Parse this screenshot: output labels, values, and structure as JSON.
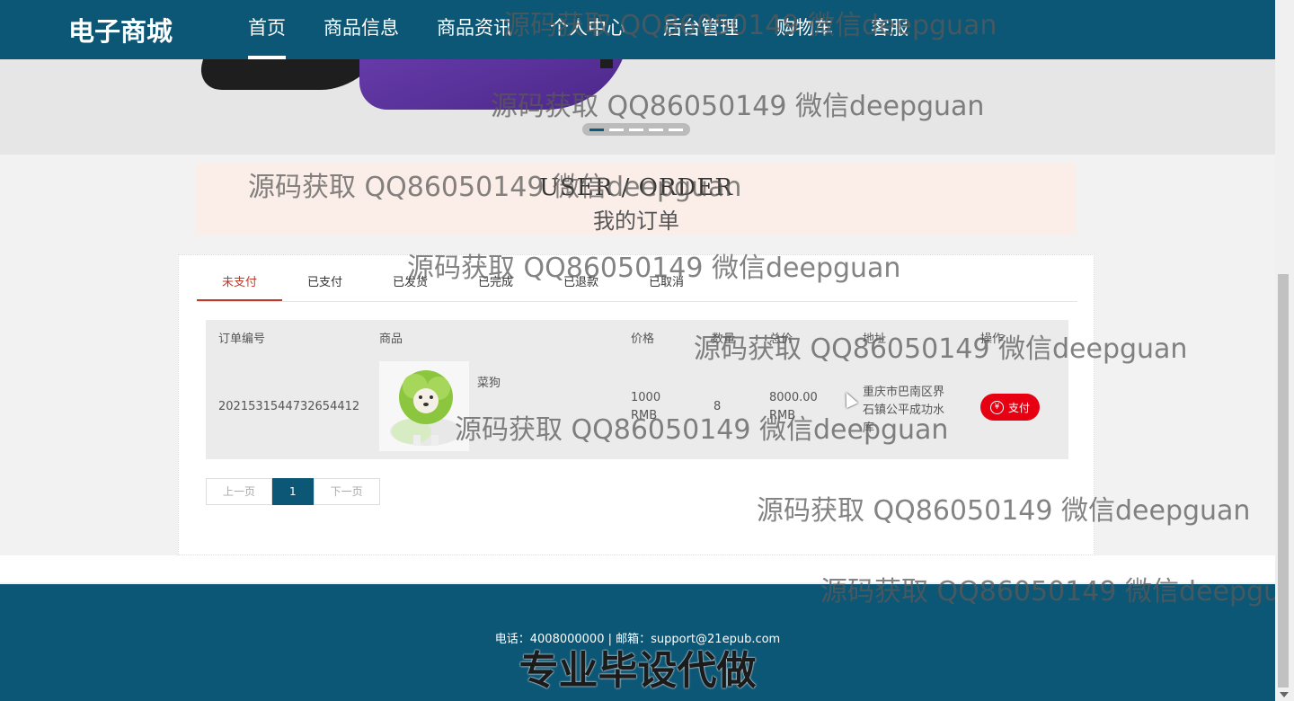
{
  "nav": {
    "brand": "电子商城",
    "items": [
      {
        "label": "首页",
        "active": true
      },
      {
        "label": "商品信息",
        "active": false
      },
      {
        "label": "商品资讯",
        "active": false
      },
      {
        "label": "个人中心",
        "active": false
      },
      {
        "label": "后台管理",
        "active": false
      },
      {
        "label": "购物车",
        "active": false
      },
      {
        "label": "客服",
        "active": false
      }
    ]
  },
  "banner": {
    "slide_count": 5,
    "active_slide": 1
  },
  "section": {
    "title_en": "USER / ORDER",
    "title_cn": "我的订单"
  },
  "tabs": [
    {
      "label": "未支付",
      "active": true
    },
    {
      "label": "已支付",
      "active": false
    },
    {
      "label": "已发货",
      "active": false
    },
    {
      "label": "已完成",
      "active": false
    },
    {
      "label": "已退款",
      "active": false
    },
    {
      "label": "已取消",
      "active": false
    }
  ],
  "table": {
    "headers": [
      "订单编号",
      "商品",
      "价格",
      "数量",
      "总价",
      "地址",
      "操作"
    ],
    "rows": [
      {
        "order_no": "2021531544732654412",
        "product": "菜狗",
        "price_value": "1000",
        "price_unit": "RMB",
        "quantity": "8",
        "total_value": "8000.00",
        "total_unit": "RMB",
        "address_line1": "重庆市巴南区界",
        "address_line2": "石镇公平成功水",
        "address_line3": "库",
        "action": "支付"
      }
    ]
  },
  "pager": {
    "prev": "上一页",
    "current": "1",
    "next": "下一页"
  },
  "footer": {
    "contact": "电话：4008000000 | 邮箱：support@21epub.com",
    "promo": "专业毕设代做"
  },
  "watermark": "源码获取 QQ86050149 微信deepguan",
  "colors": {
    "primary": "#0c5676",
    "accent": "#c0392b",
    "pay": "#e60012",
    "title_bg": "#fbeee8"
  }
}
